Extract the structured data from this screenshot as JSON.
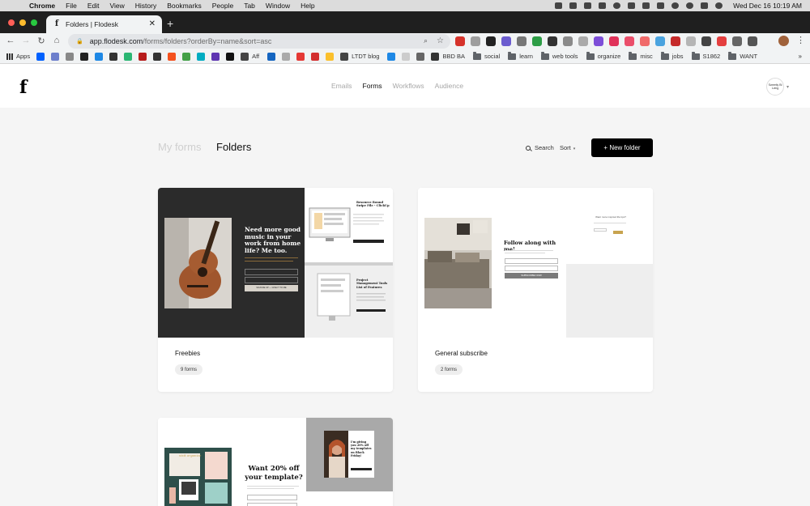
{
  "menubar": {
    "app_name": "Chrome",
    "items": [
      "File",
      "Edit",
      "View",
      "History",
      "Bookmarks",
      "People",
      "Tab",
      "Window",
      "Help"
    ],
    "clock": "Wed Dec 16  10:19 AM"
  },
  "browser": {
    "tab_title": "Folders | Flodesk",
    "url_host": "app.flodesk.com",
    "url_path": "/forms/folders?orderBy=name&sort=asc"
  },
  "bookmarks": {
    "apps_label": "Apps",
    "named": [
      {
        "label": "LTDT blog",
        "folder": false
      },
      {
        "label": "BBD BA",
        "folder": false
      },
      {
        "label": "social",
        "folder": true
      },
      {
        "label": "learn",
        "folder": true
      },
      {
        "label": "web tools",
        "folder": true
      },
      {
        "label": "organize",
        "folder": true
      },
      {
        "label": "misc",
        "folder": true
      },
      {
        "label": "jobs",
        "folder": true
      },
      {
        "label": "S1862",
        "folder": true
      },
      {
        "label": "WANT",
        "folder": true
      }
    ],
    "aff_label": "Aff",
    "more": "»"
  },
  "app": {
    "logo": "f",
    "nav": [
      "Emails",
      "Forms",
      "Workflows",
      "Audience"
    ],
    "active_nav": "Forms",
    "account_initials": "Sweetly Bi Lving"
  },
  "page": {
    "tab_my_forms": "My forms",
    "tab_folders": "Folders",
    "search_label": "Search",
    "sort_label": "Sort",
    "new_folder_label": "+ New folder"
  },
  "folders": [
    {
      "name": "Freebies",
      "count": "9 forms",
      "preview_headline": "Need more good music in your work from home life? Me too.",
      "preview_right_top": "Resource Round Swipe File - ClickUp",
      "preview_right_bottom": "Project Management Tools List of Features",
      "preview_button": "SIGN ME UP — GIVE IT TO ME"
    },
    {
      "name": "General subscribe",
      "count": "2 forms",
      "preview_headline": "Follow along with me!",
      "preview_button": "SUBSCRIBE NOW",
      "preview_right_top": "Want more inspired life tips?"
    },
    {
      "name": "",
      "count": "",
      "preview_headline": "Want 20% off your template?",
      "preview_right_top": "I'm giving you 20% off my templates on Black Friday!",
      "preview_left_script": "visit organize"
    }
  ],
  "colors": {
    "accent": "#000000",
    "page_bg": "#f5f5f5",
    "freebies_bg": "#2b2b2b",
    "teal_bg": "#2e4f4a",
    "gold": "#c8a34f"
  }
}
